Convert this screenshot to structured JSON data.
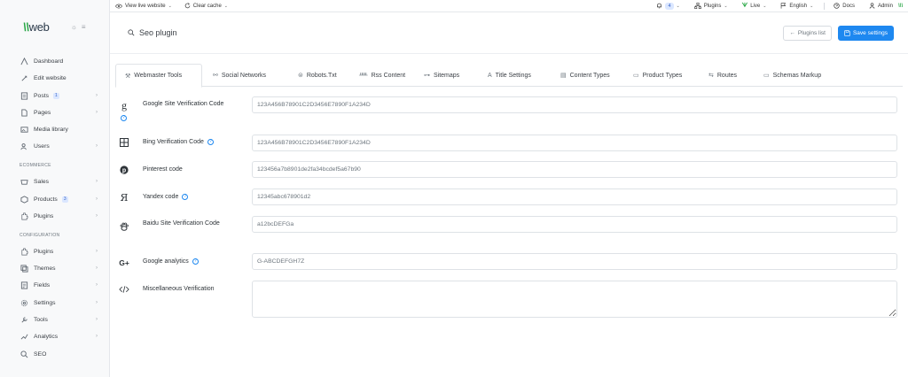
{
  "topbar": {
    "view_live": "View live website",
    "clear_cache": "Clear cache",
    "notifications_count": "4",
    "plugins": "Plugins",
    "live": "Live",
    "language": "English",
    "docs": "Docs",
    "admin": "Admin"
  },
  "sidebar": {
    "logo": "web",
    "items_main": [
      {
        "label": "Dashboard",
        "icon": "dashboard-icon"
      },
      {
        "label": "Edit website",
        "icon": "edit-icon"
      },
      {
        "label": "Posts",
        "icon": "posts-icon",
        "badge": "1"
      },
      {
        "label": "Pages",
        "icon": "pages-icon"
      },
      {
        "label": "Media library",
        "icon": "media-icon"
      },
      {
        "label": "Users",
        "icon": "users-icon"
      }
    ],
    "section_ecommerce": "ECOMMERCE",
    "items_ecommerce": [
      {
        "label": "Sales",
        "icon": "sales-icon"
      },
      {
        "label": "Products",
        "icon": "products-icon",
        "badge": "3"
      },
      {
        "label": "Plugins",
        "icon": "plugins-icon"
      }
    ],
    "section_configuration": "CONFIGURATION",
    "items_configuration": [
      {
        "label": "Plugins",
        "icon": "plugins-icon"
      },
      {
        "label": "Themes",
        "icon": "themes-icon"
      },
      {
        "label": "Fields",
        "icon": "fields-icon"
      },
      {
        "label": "Settings",
        "icon": "settings-icon"
      },
      {
        "label": "Tools",
        "icon": "tools-icon"
      },
      {
        "label": "Analytics",
        "icon": "analytics-icon"
      },
      {
        "label": "SEO",
        "icon": "seo-icon"
      }
    ]
  },
  "page": {
    "title": "Seo plugin",
    "plugins_list": "Plugins list",
    "save_settings": "Save settings"
  },
  "tabs": [
    "Webmaster Tools",
    "Social Networks",
    "Robots.Txt",
    "Rss Content",
    "Sitemaps",
    "Title Settings",
    "Content Types",
    "Product Types",
    "Routes",
    "Schemas Markup"
  ],
  "fields": [
    {
      "label": "Google Site Verification Code",
      "placeholder": "123A456B78901C2D3456E7890F1A234D",
      "icon": "google-icon"
    },
    {
      "label": "Bing Verification Code",
      "placeholder": "123A456B78901C2D3456E7890F1A234D",
      "icon": "windows-icon"
    },
    {
      "label": "Pinterest code",
      "placeholder": "123456a7b8901de2fa34bcdef5a67b90",
      "icon": "pinterest-icon"
    },
    {
      "label": "Yandex code",
      "placeholder": "12345abc678901d2",
      "icon": "yandex-icon"
    },
    {
      "label": "Baidu Site Verification Code",
      "placeholder": "a12bcDEFGa",
      "icon": "baidu-icon"
    },
    {
      "label": "Google analytics",
      "placeholder": "G-ABCDEFGH7Z",
      "icon": "google-plus-icon"
    },
    {
      "label": "Miscellaneous Verification",
      "placeholder": "",
      "icon": "code-icon"
    }
  ],
  "colors": {
    "primary": "#1e88f0",
    "brand_green": "#28a745",
    "badge_bg": "#dbe7ff"
  }
}
